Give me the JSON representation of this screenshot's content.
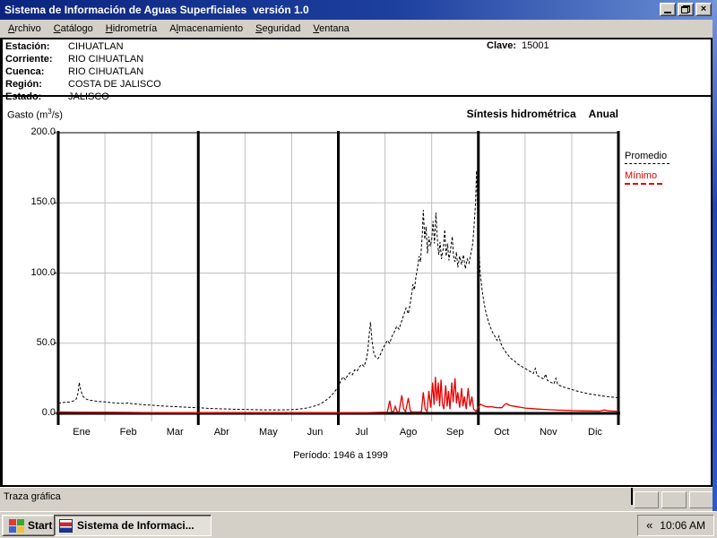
{
  "window": {
    "title": "Sistema de Información de Aguas Superficiales  versión 1.0",
    "controls": [
      {
        "name": "minimize"
      },
      {
        "name": "restore"
      },
      {
        "name": "close",
        "glyph": "×"
      }
    ]
  },
  "menu": {
    "items": [
      {
        "pre": "",
        "key": "A",
        "post": "rchivo"
      },
      {
        "pre": "",
        "key": "C",
        "post": "atálogo"
      },
      {
        "pre": "",
        "key": "H",
        "post": "idrometría"
      },
      {
        "pre": "A",
        "key": "l",
        "post": "macenamiento"
      },
      {
        "pre": "",
        "key": "S",
        "post": "eguridad"
      },
      {
        "pre": "",
        "key": "V",
        "post": "entana"
      }
    ]
  },
  "header": {
    "rows": [
      {
        "label": "Estación:",
        "value": "CIHUATLAN"
      },
      {
        "label": "Corriente:",
        "value": "RIO CIHUATLAN"
      },
      {
        "label": "Cuenca:",
        "value": "RIO CIHUATLAN"
      },
      {
        "label": "Región:",
        "value": "COSTA DE JALISCO"
      },
      {
        "label": "Estado:",
        "value": "JALISCO"
      }
    ],
    "clave_label": "Clave:",
    "clave_value": "15001"
  },
  "chart_header": {
    "y_title_pre": "Gasto (m",
    "y_title_sup": "3",
    "y_title_post": "/s)",
    "right_title": "Síntesis hidrométrica",
    "right_mode": "Anual"
  },
  "chart_data": {
    "type": "line",
    "title": "Síntesis hidrométrica Anual",
    "ylabel": "Gasto (m3/s)",
    "xlabel": "",
    "ylim": [
      0,
      200
    ],
    "yticks": [
      0,
      50,
      100,
      150,
      200
    ],
    "ytick_labels": [
      "0.0",
      "50.0",
      "100.0",
      "150.0",
      "200.0"
    ],
    "categories": [
      "Ene",
      "Feb",
      "Mar",
      "Abr",
      "May",
      "Jun",
      "Jul",
      "Ago",
      "Sep",
      "Oct",
      "Nov",
      "Dic"
    ],
    "x_unit": "month index 0-12 (day-of-year fraction)",
    "quarter_lines_at_month": [
      3,
      6,
      9
    ],
    "grid": true,
    "grid_color": "#c0c0c0",
    "legend_position": "outside-right-top",
    "annotation": "Período:  1946 a 1999",
    "series": [
      {
        "name": "Promedio",
        "color": "#000000",
        "style": "dashed",
        "points": [
          [
            0,
            7.2
          ],
          [
            0.12,
            7.8
          ],
          [
            0.25,
            8.2
          ],
          [
            0.32,
            8.8
          ],
          [
            0.38,
            10
          ],
          [
            0.42,
            14
          ],
          [
            0.45,
            22
          ],
          [
            0.48,
            17
          ],
          [
            0.52,
            12.5
          ],
          [
            0.58,
            10.5
          ],
          [
            0.65,
            9.5
          ],
          [
            0.75,
            9
          ],
          [
            0.85,
            8.5
          ],
          [
            1,
            8.2
          ],
          [
            1.15,
            7.6
          ],
          [
            1.3,
            7.2
          ],
          [
            1.45,
            7
          ],
          [
            1.5,
            7.6
          ],
          [
            1.55,
            7
          ],
          [
            1.7,
            6.5
          ],
          [
            1.85,
            6.1
          ],
          [
            2,
            5.8
          ],
          [
            2.2,
            5.3
          ],
          [
            2.4,
            5
          ],
          [
            2.6,
            4.6
          ],
          [
            2.8,
            4.3
          ],
          [
            3,
            4
          ],
          [
            3.2,
            3.6
          ],
          [
            3.4,
            3.3
          ],
          [
            3.6,
            3.1
          ],
          [
            3.8,
            2.9
          ],
          [
            4,
            2.8
          ],
          [
            4.2,
            2.6
          ],
          [
            4.4,
            2.5
          ],
          [
            4.6,
            2.4
          ],
          [
            4.8,
            2.5
          ],
          [
            5,
            2.7
          ],
          [
            5.15,
            3
          ],
          [
            5.3,
            3.7
          ],
          [
            5.45,
            4.8
          ],
          [
            5.6,
            6.5
          ],
          [
            5.7,
            8.5
          ],
          [
            5.8,
            11
          ],
          [
            5.9,
            14.5
          ],
          [
            6,
            19
          ],
          [
            6.05,
            23
          ],
          [
            6.1,
            26
          ],
          [
            6.15,
            24
          ],
          [
            6.2,
            27
          ],
          [
            6.25,
            29
          ],
          [
            6.3,
            27.5
          ],
          [
            6.35,
            31
          ],
          [
            6.4,
            30
          ],
          [
            6.45,
            33
          ],
          [
            6.5,
            35
          ],
          [
            6.55,
            33.5
          ],
          [
            6.6,
            38
          ],
          [
            6.63,
            44
          ],
          [
            6.66,
            56
          ],
          [
            6.69,
            65
          ],
          [
            6.72,
            52
          ],
          [
            6.76,
            43
          ],
          [
            6.8,
            40
          ],
          [
            6.85,
            39
          ],
          [
            6.9,
            42
          ],
          [
            6.95,
            46
          ],
          [
            7,
            49
          ],
          [
            7.05,
            52
          ],
          [
            7.1,
            50
          ],
          [
            7.15,
            55
          ],
          [
            7.2,
            58
          ],
          [
            7.25,
            62
          ],
          [
            7.3,
            60
          ],
          [
            7.35,
            65
          ],
          [
            7.4,
            70
          ],
          [
            7.45,
            75
          ],
          [
            7.5,
            71
          ],
          [
            7.55,
            80
          ],
          [
            7.6,
            92
          ],
          [
            7.63,
            88
          ],
          [
            7.66,
            97
          ],
          [
            7.7,
            104
          ],
          [
            7.73,
            112
          ],
          [
            7.76,
            108
          ],
          [
            7.8,
            129
          ],
          [
            7.82,
            145
          ],
          [
            7.85,
            124
          ],
          [
            7.88,
            133
          ],
          [
            7.91,
            114
          ],
          [
            7.94,
            126
          ],
          [
            7.97,
            119
          ],
          [
            8,
            124
          ],
          [
            8.03,
            137
          ],
          [
            8.06,
            121
          ],
          [
            8.09,
            143
          ],
          [
            8.12,
            125
          ],
          [
            8.15,
            113
          ],
          [
            8.18,
            122
          ],
          [
            8.21,
            110
          ],
          [
            8.25,
            118
          ],
          [
            8.28,
            131
          ],
          [
            8.31,
            112
          ],
          [
            8.34,
            121
          ],
          [
            8.37,
            109
          ],
          [
            8.4,
            116
          ],
          [
            8.44,
            126
          ],
          [
            8.47,
            112
          ],
          [
            8.5,
            108
          ],
          [
            8.53,
            115
          ],
          [
            8.56,
            104
          ],
          [
            8.6,
            112
          ],
          [
            8.64,
            106
          ],
          [
            8.68,
            113
          ],
          [
            8.72,
            103
          ],
          [
            8.76,
            110
          ],
          [
            8.8,
            107
          ],
          [
            8.84,
            114
          ],
          [
            8.88,
            121
          ],
          [
            8.91,
            135
          ],
          [
            8.94,
            150
          ],
          [
            8.96,
            173
          ],
          [
            8.98,
            148
          ],
          [
            9,
            122
          ],
          [
            9.04,
            100
          ],
          [
            9.08,
            88
          ],
          [
            9.12,
            79
          ],
          [
            9.16,
            72
          ],
          [
            9.2,
            67
          ],
          [
            9.25,
            62
          ],
          [
            9.3,
            58
          ],
          [
            9.35,
            55
          ],
          [
            9.4,
            52
          ],
          [
            9.44,
            55
          ],
          [
            9.48,
            50
          ],
          [
            9.52,
            47
          ],
          [
            9.56,
            45
          ],
          [
            9.6,
            43
          ],
          [
            9.65,
            41
          ],
          [
            9.7,
            39
          ],
          [
            9.75,
            38
          ],
          [
            9.8,
            36.5
          ],
          [
            9.85,
            35
          ],
          [
            9.9,
            34
          ],
          [
            9.95,
            33
          ],
          [
            10,
            32
          ],
          [
            10.1,
            30
          ],
          [
            10.18,
            28.5
          ],
          [
            10.22,
            32
          ],
          [
            10.26,
            27
          ],
          [
            10.34,
            25.5
          ],
          [
            10.4,
            24.5
          ],
          [
            10.44,
            28
          ],
          [
            10.48,
            23.5
          ],
          [
            10.56,
            22
          ],
          [
            10.62,
            21
          ],
          [
            10.66,
            25
          ],
          [
            10.7,
            20.5
          ],
          [
            10.8,
            19
          ],
          [
            10.9,
            18
          ],
          [
            11,
            17
          ],
          [
            11.1,
            16
          ],
          [
            11.2,
            15.2
          ],
          [
            11.35,
            14
          ],
          [
            11.5,
            13.2
          ],
          [
            11.65,
            12.4
          ],
          [
            11.8,
            11.8
          ],
          [
            12,
            11.2
          ]
        ]
      },
      {
        "name": "Mínimo",
        "color": "#e60000",
        "style": "solid",
        "points": [
          [
            0,
            1
          ],
          [
            0.5,
            0.9
          ],
          [
            1,
            0.8
          ],
          [
            1.5,
            0.7
          ],
          [
            2,
            0.6
          ],
          [
            2.5,
            0.5
          ],
          [
            3,
            0.45
          ],
          [
            3.5,
            0.4
          ],
          [
            4,
            0.4
          ],
          [
            4.5,
            0.4
          ],
          [
            5,
            0.4
          ],
          [
            5.5,
            0.45
          ],
          [
            6,
            0.5
          ],
          [
            6.3,
            0.55
          ],
          [
            6.6,
            0.6
          ],
          [
            6.8,
            0.7
          ],
          [
            6.95,
            0.8
          ],
          [
            7.05,
            0.9
          ],
          [
            7.1,
            9
          ],
          [
            7.14,
            1.5
          ],
          [
            7.18,
            1
          ],
          [
            7.22,
            5
          ],
          [
            7.26,
            1.2
          ],
          [
            7.3,
            0.9
          ],
          [
            7.36,
            13
          ],
          [
            7.4,
            3
          ],
          [
            7.44,
            1.2
          ],
          [
            7.5,
            11
          ],
          [
            7.54,
            2
          ],
          [
            7.58,
            1
          ],
          [
            7.65,
            1
          ],
          [
            7.72,
            1
          ],
          [
            7.78,
            1.2
          ],
          [
            7.82,
            15
          ],
          [
            7.86,
            3
          ],
          [
            7.9,
            1.5
          ],
          [
            7.94,
            16
          ],
          [
            7.98,
            4
          ],
          [
            8.02,
            22
          ],
          [
            8.05,
            6
          ],
          [
            8.08,
            26
          ],
          [
            8.11,
            9
          ],
          [
            8.14,
            22
          ],
          [
            8.17,
            5
          ],
          [
            8.2,
            24
          ],
          [
            8.23,
            7
          ],
          [
            8.26,
            3
          ],
          [
            8.3,
            20
          ],
          [
            8.33,
            5
          ],
          [
            8.36,
            16
          ],
          [
            8.39,
            3
          ],
          [
            8.43,
            22
          ],
          [
            8.46,
            8
          ],
          [
            8.5,
            25
          ],
          [
            8.53,
            7
          ],
          [
            8.56,
            15
          ],
          [
            8.6,
            4
          ],
          [
            8.64,
            18
          ],
          [
            8.67,
            5
          ],
          [
            8.7,
            12
          ],
          [
            8.74,
            3
          ],
          [
            8.78,
            18
          ],
          [
            8.82,
            5
          ],
          [
            8.86,
            12
          ],
          [
            8.9,
            3
          ],
          [
            8.95,
            1.5
          ],
          [
            9,
            4.5
          ],
          [
            9.05,
            6.5
          ],
          [
            9.1,
            5.5
          ],
          [
            9.15,
            5
          ],
          [
            9.2,
            4.6
          ],
          [
            9.28,
            4.8
          ],
          [
            9.35,
            4.3
          ],
          [
            9.42,
            4
          ],
          [
            9.5,
            4
          ],
          [
            9.55,
            5.8
          ],
          [
            9.6,
            7
          ],
          [
            9.65,
            6
          ],
          [
            9.7,
            5.4
          ],
          [
            9.78,
            5
          ],
          [
            9.85,
            4.6
          ],
          [
            9.92,
            4.2
          ],
          [
            10,
            3.8
          ],
          [
            10.15,
            3.4
          ],
          [
            10.3,
            3
          ],
          [
            10.5,
            2.6
          ],
          [
            10.7,
            2.3
          ],
          [
            10.9,
            2.1
          ],
          [
            11,
            2
          ],
          [
            11.2,
            1.8
          ],
          [
            11.4,
            1.7
          ],
          [
            11.6,
            1.6
          ],
          [
            11.7,
            2.4
          ],
          [
            11.78,
            1.8
          ],
          [
            11.9,
            1.6
          ],
          [
            12,
            1.5
          ]
        ]
      }
    ]
  },
  "status_bar": {
    "message": "Traza gráfica"
  },
  "taskbar": {
    "start_label": "Start",
    "task_label": "Sistema de Informaci...",
    "tray_chevron": "«",
    "clock": "10:06 AM"
  },
  "colors": {
    "titlebar": "#0b257f",
    "chrome_gray": "#d4d0c8",
    "promedio": "#000000",
    "minimo": "#e60000"
  }
}
